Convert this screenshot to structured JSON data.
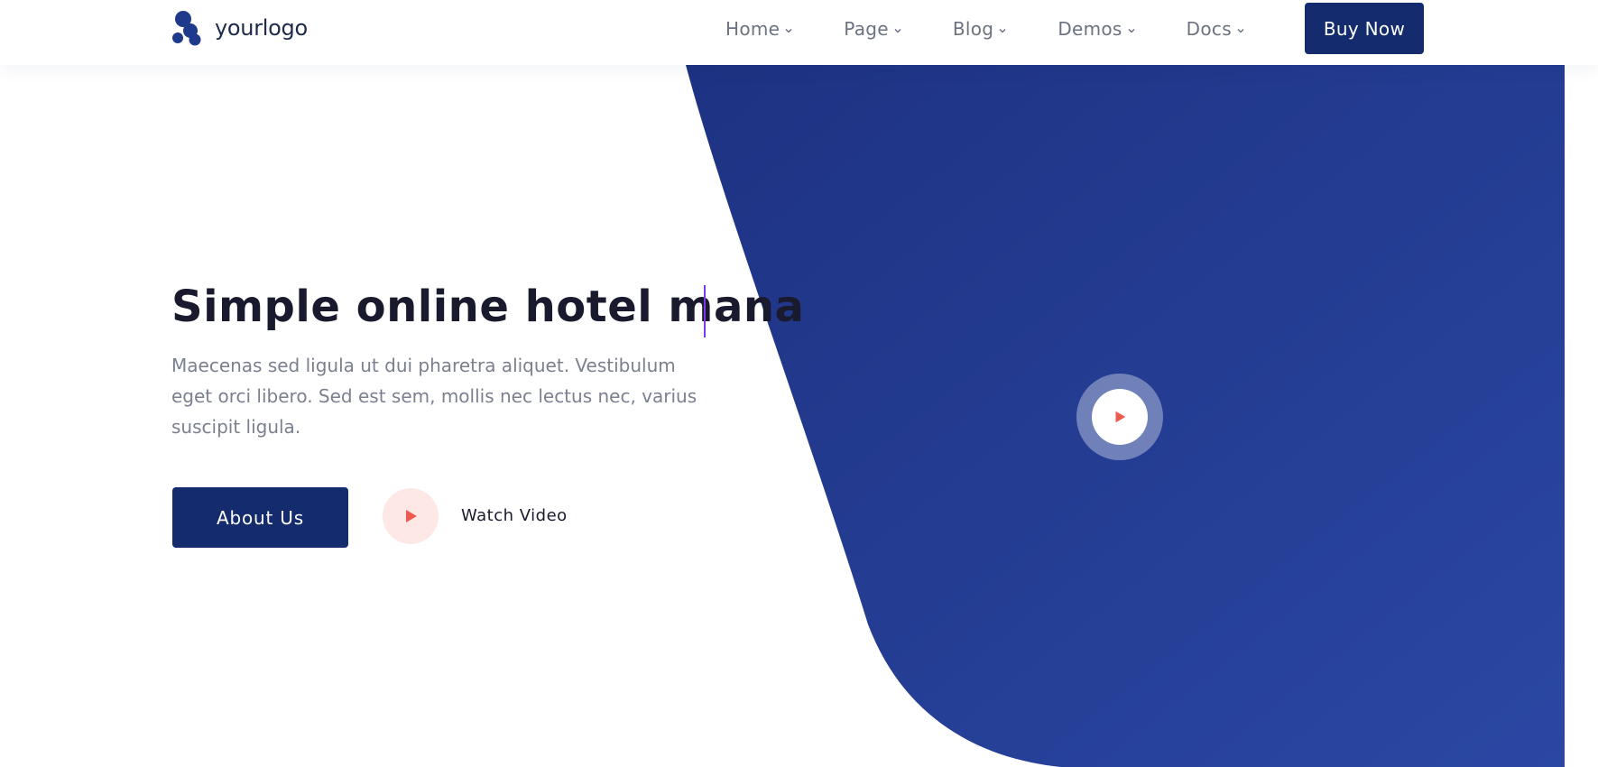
{
  "header": {
    "logo": {
      "text": "yourlogo",
      "icon": "logo-blobs-icon"
    },
    "nav": [
      {
        "label": "Home",
        "icon": "chevron-down-icon"
      },
      {
        "label": "Page",
        "icon": "chevron-down-icon"
      },
      {
        "label": "Blog",
        "icon": "chevron-down-icon"
      },
      {
        "label": "Demos",
        "icon": "chevron-down-icon"
      },
      {
        "label": "Docs",
        "icon": "chevron-down-icon"
      }
    ],
    "cta_label": "Buy Now"
  },
  "hero": {
    "title": "Simple online hotel mana",
    "description": "Maecenas sed ligula ut dui pharetra aliquet. Vestibulum eget orci libero. Sed est sem, mollis nec lectus nec, varius suscipit ligula.",
    "primary_button": "About Us",
    "watch_video_label": "Watch Video",
    "watch_icon": "play-icon",
    "video_icon": "play-icon"
  },
  "colors": {
    "brand_navy": "#142b6e",
    "shape_gradient_start": "#1e3282",
    "shape_gradient_end": "#2a47a3",
    "play_accent": "#ef5a4f",
    "play_bg": "#fde8e6",
    "caret": "#7c3aed",
    "muted_text": "#7b8090"
  }
}
